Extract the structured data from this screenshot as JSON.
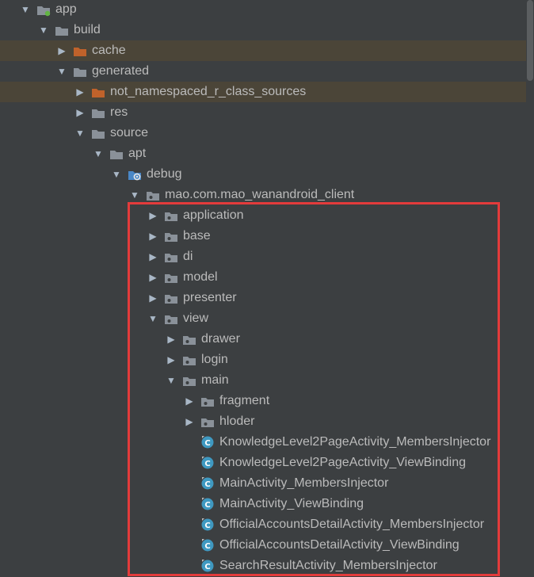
{
  "colors": {
    "background": "#3c3f41",
    "text": "#bbbbbb",
    "folder_gray": "#8a9199",
    "folder_orange": "#c0622b",
    "class_teal": "#3f99c1",
    "highlight_row": "#4b4538",
    "annotation_red": "#e33b3b"
  },
  "tree": {
    "items": [
      {
        "label": "app",
        "icon": "module-folder-icon",
        "expanded": true,
        "highlighted": false
      },
      {
        "label": "build",
        "icon": "folder-icon",
        "expanded": true,
        "highlighted": false
      },
      {
        "label": "cache",
        "icon": "excluded-folder-icon",
        "expanded": false,
        "highlighted": true
      },
      {
        "label": "generated",
        "icon": "folder-icon",
        "expanded": true,
        "highlighted": false
      },
      {
        "label": "not_namespaced_r_class_sources",
        "icon": "excluded-folder-icon",
        "expanded": false,
        "highlighted": true
      },
      {
        "label": "res",
        "icon": "folder-icon",
        "expanded": false,
        "highlighted": false
      },
      {
        "label": "source",
        "icon": "folder-icon",
        "expanded": true,
        "highlighted": false
      },
      {
        "label": "apt",
        "icon": "folder-icon",
        "expanded": true,
        "highlighted": false
      },
      {
        "label": "debug",
        "icon": "generated-source-root-icon",
        "expanded": true,
        "highlighted": false
      },
      {
        "label": "mao.com.mao_wanandroid_client",
        "icon": "package-icon",
        "expanded": true,
        "highlighted": false
      },
      {
        "label": "application",
        "icon": "package-icon",
        "expanded": false,
        "highlighted": false
      },
      {
        "label": "base",
        "icon": "package-icon",
        "expanded": false,
        "highlighted": false
      },
      {
        "label": "di",
        "icon": "package-icon",
        "expanded": false,
        "highlighted": false
      },
      {
        "label": "model",
        "icon": "package-icon",
        "expanded": false,
        "highlighted": false
      },
      {
        "label": "presenter",
        "icon": "package-icon",
        "expanded": false,
        "highlighted": false
      },
      {
        "label": "view",
        "icon": "package-icon",
        "expanded": true,
        "highlighted": false
      },
      {
        "label": "drawer",
        "icon": "package-icon",
        "expanded": false,
        "highlighted": false
      },
      {
        "label": "login",
        "icon": "package-icon",
        "expanded": false,
        "highlighted": false
      },
      {
        "label": "main",
        "icon": "package-icon",
        "expanded": true,
        "highlighted": false
      },
      {
        "label": "fragment",
        "icon": "package-icon",
        "expanded": false,
        "highlighted": false
      },
      {
        "label": "hloder",
        "icon": "package-icon",
        "expanded": false,
        "highlighted": false
      },
      {
        "label": "KnowledgeLevel2PageActivity_MembersInjector",
        "icon": "class-icon",
        "expanded": null,
        "highlighted": false
      },
      {
        "label": "KnowledgeLevel2PageActivity_ViewBinding",
        "icon": "class-icon",
        "expanded": null,
        "highlighted": false
      },
      {
        "label": "MainActivity_MembersInjector",
        "icon": "class-icon",
        "expanded": null,
        "highlighted": false
      },
      {
        "label": "MainActivity_ViewBinding",
        "icon": "class-icon",
        "expanded": null,
        "highlighted": false
      },
      {
        "label": "OfficialAccountsDetailActivity_MembersInjector",
        "icon": "class-icon",
        "expanded": null,
        "highlighted": false
      },
      {
        "label": "OfficialAccountsDetailActivity_ViewBinding",
        "icon": "class-icon",
        "expanded": null,
        "highlighted": false
      },
      {
        "label": "SearchResultActivity_MembersInjector",
        "icon": "class-icon",
        "expanded": null,
        "highlighted": false
      }
    ]
  }
}
